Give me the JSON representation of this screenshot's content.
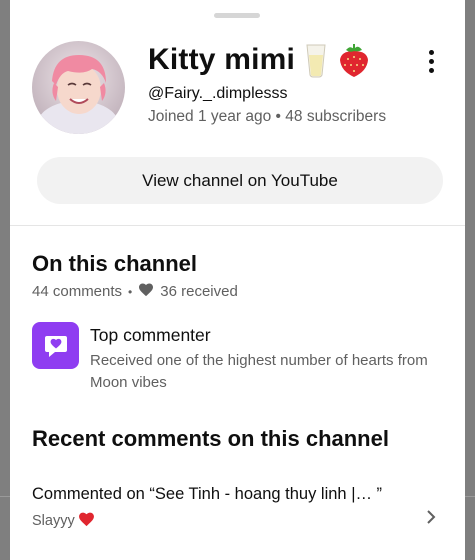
{
  "channel": {
    "name": "Kitty mimi",
    "name_emojis": [
      "milk-glass-icon",
      "strawberry-icon"
    ],
    "handle": "@Fairy._.dimplesss",
    "meta": "Joined 1 year ago • 48 subscribers",
    "view_button": "View channel on YouTube"
  },
  "on_channel": {
    "title": "On this channel",
    "comments": "44 comments",
    "received": "36 received",
    "badge": {
      "title": "Top commenter",
      "description": "Received one of the highest number of hearts from Moon vibes",
      "color": "#8f3df1"
    }
  },
  "recent": {
    "title": "Recent comments on this channel",
    "items": [
      {
        "commented_on": "Commented on “See Tinh - hoang thuy linh |… ”",
        "text": "Slayyy"
      }
    ]
  }
}
